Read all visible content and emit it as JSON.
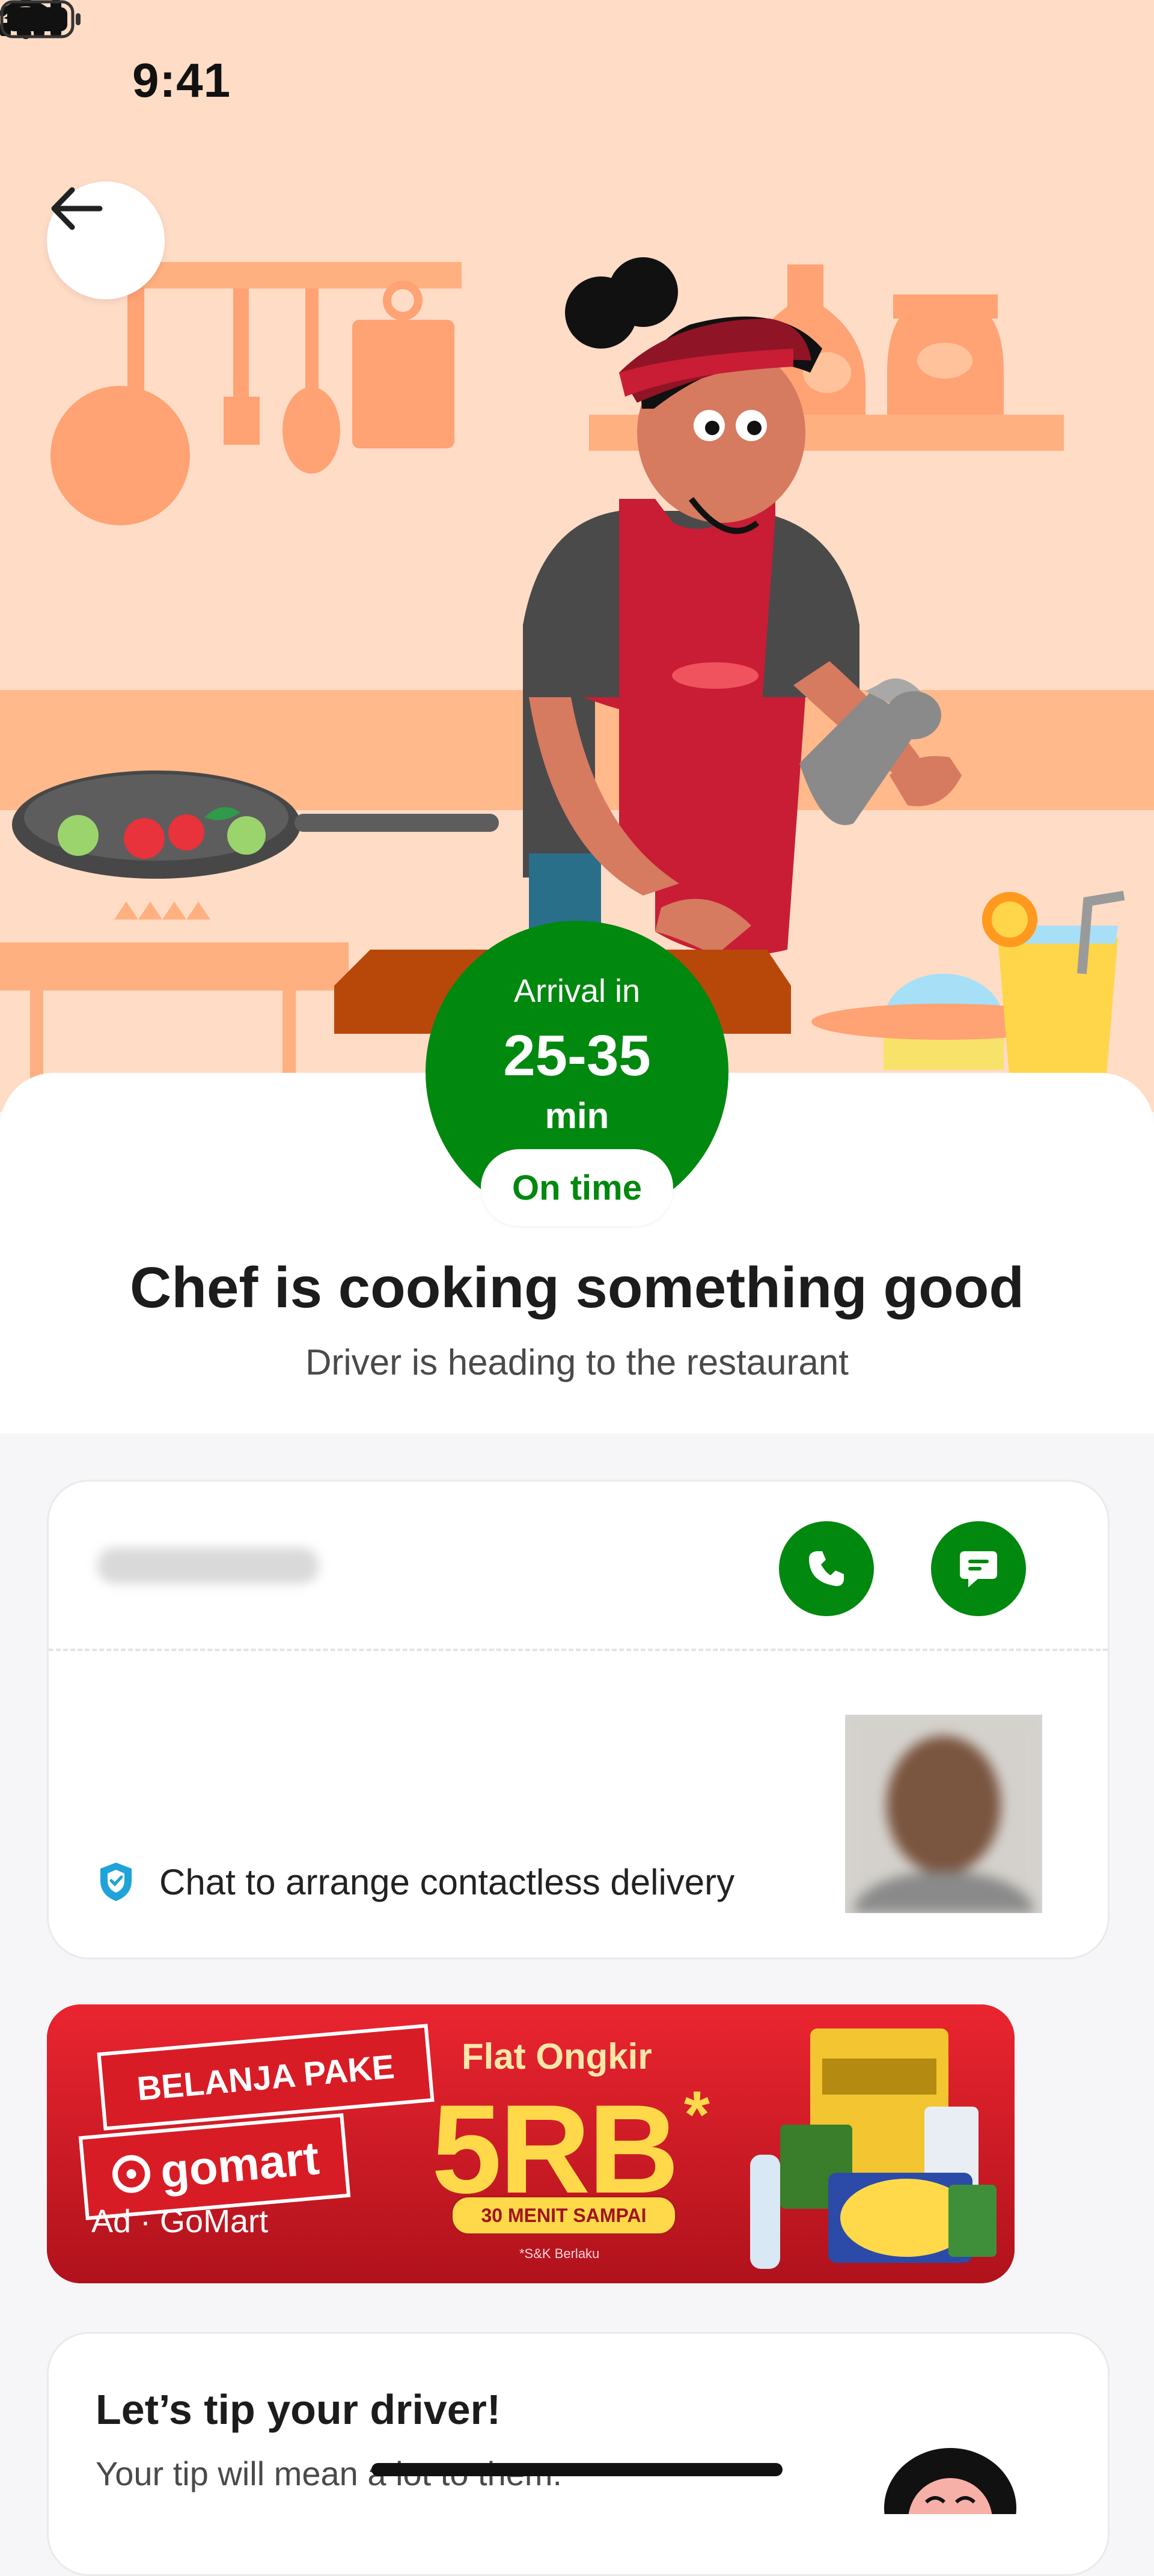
{
  "status_bar": {
    "time": "9:41",
    "icons": [
      "location-arrow-icon",
      "signal-icon",
      "wifi-icon",
      "battery-icon"
    ]
  },
  "navigation": {
    "back_icon": "arrow-left-icon"
  },
  "arrival": {
    "label": "Arrival in",
    "time": "25-35",
    "unit": "min",
    "status": "On time"
  },
  "order_status": {
    "headline": "Chef is cooking something good",
    "subline": "Driver is heading to the restaurant"
  },
  "driver_card": {
    "call_icon": "phone-icon",
    "chat_icon": "chat-icon",
    "contactless_text": "Chat to arrange contactless delivery"
  },
  "ad_banner": {
    "tag_line": "BELANJA PAKE",
    "brand": "gomart",
    "headline": "Flat Ongkir",
    "price": "5RB",
    "asterisk": "*",
    "pill": "30 MENIT SAMPAI",
    "terms": "*S&K Berlaku",
    "caption": "Ad · GoMart"
  },
  "tip_card": {
    "title": "Let’s tip your driver!",
    "subtitle": "Your tip will mean a lot to them."
  },
  "colors": {
    "primary_green": "#00880f",
    "hero_bg": "#ffdcc6",
    "ad_red": "#e8222d"
  }
}
